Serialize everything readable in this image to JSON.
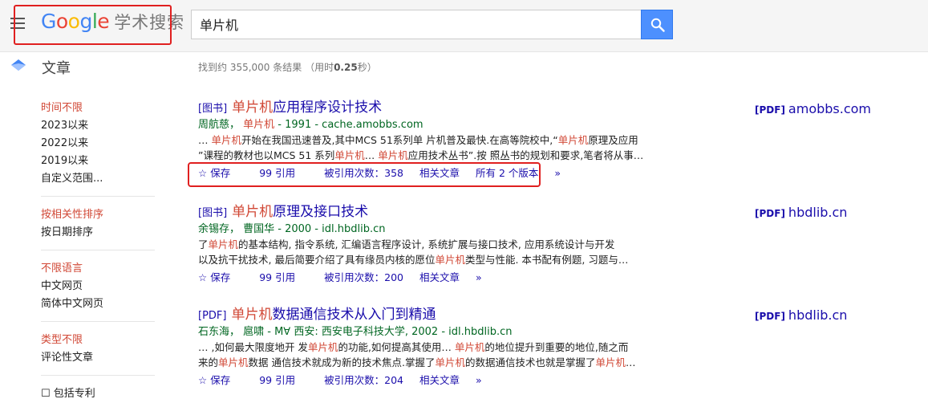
{
  "header": {
    "logo": {
      "G": "G",
      "o1": "o",
      "o2": "o",
      "g": "g",
      "l": "l",
      "e": "e",
      "scholar": "学术搜索"
    },
    "search": {
      "value": "单片机"
    }
  },
  "subheader": {
    "section": "文章",
    "stats_prefix": "找到约 355,000 条结果 （用时",
    "stats_time": "0.25",
    "stats_suffix": "秒）"
  },
  "sidebar": {
    "time": [
      "时间不限",
      "2023以来",
      "2022以来",
      "2019以来",
      "自定义范围..."
    ],
    "sort": [
      "按相关性排序",
      "按日期排序"
    ],
    "lang": [
      "不限语言",
      "中文网页",
      "简体中文网页"
    ],
    "type": [
      "类型不限",
      "评论性文章"
    ],
    "more": "包括专利"
  },
  "results": [
    {
      "type": "[图书]",
      "title_hl": "单片机",
      "title_rest": "应用程序设计技术",
      "authors": "周航慈，",
      "meta_hl": "单片机",
      "meta_rest": " - 1991 - cache.amobbs.com",
      "line1_a": "… ",
      "line1_hl": "单片机",
      "line1_b": "开始在我国迅速普及,其中MCS 51系列单 片机普及最快.在高等院校中,“",
      "line1_hl2": "单片机",
      "line1_c": "原理及应用",
      "line2_a": "”课程的教材也以MCS 51 系列",
      "line2_hl": "单片机",
      "line2_b": "… ",
      "line2_hl2": "单片机",
      "line2_c": "应用技术丛书”.按 照丛书的规划和要求,笔者将从事…",
      "save": "保存",
      "cite": "引用",
      "cited": "被引用次数：358",
      "related": "相关文章",
      "versions": "所有 2 个版本",
      "pdf_tag": "[PDF]",
      "pdf_domain": "amobbs.com"
    },
    {
      "type": "[图书]",
      "title_hl": "单片机",
      "title_rest": "原理及接口技术",
      "meta": "余锡存，  曹国华 - 2000 - idl.hbdlib.cn",
      "line1_a": "了",
      "line1_hl": "单片机",
      "line1_b": "的基本结构, 指令系统, 汇编语言程序设计, 系统扩展与接口技术, 应用系统设计与开发",
      "line2_a": "以及抗干扰技术, 最后简要介绍了具有缘员内核的愿位",
      "line2_hl": "单片机",
      "line2_b": "类型与性能. 本书配有例题, 习题与…",
      "save": "保存",
      "cite": "引用",
      "cited": "被引用次数：200",
      "related": "相关文章",
      "pdf_tag": "[PDF]",
      "pdf_domain": "hbdlib.cn"
    },
    {
      "type": "[PDF]",
      "title_hl": "单片机",
      "title_rest": "数据通信技术从入门到精通",
      "meta": "石东海，  扈啸 - M∀ 西安: 西安电子科技大学, 2002 - idl.hbdlib.cn",
      "line1_a": "… ,如何最大限度地开 发",
      "line1_hl": "单片机",
      "line1_b": "的功能,如何提高其使用… ",
      "line1_hl2": "单片机",
      "line1_c": "的地位提升到重要的地位,随之而",
      "line2_a": "来的",
      "line2_hl": "单片机",
      "line2_b": "数据 通信技术就成为新的技术焦点.掌握了",
      "line2_hl2": "单片机",
      "line2_c": "的数据通信技术也就是掌握了",
      "line2_hl3": "单片机",
      "line2_d": "…",
      "save": "保存",
      "cite": "引用",
      "cited": "被引用次数：204",
      "related": "相关文章",
      "pdf_tag": "[PDF]",
      "pdf_domain": "hbdlib.cn"
    }
  ],
  "colors": {
    "accent": "#4d90fe",
    "link": "#1a0dab",
    "highlight": "#d14836",
    "meta": "#006621",
    "annotation": "#e02020"
  }
}
